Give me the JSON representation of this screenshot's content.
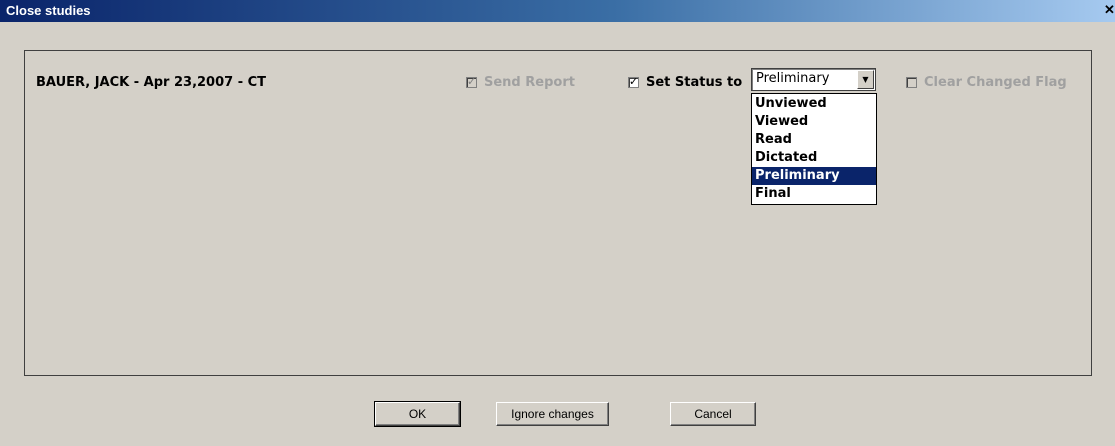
{
  "window": {
    "title": "Close studies",
    "close_glyph": "✕"
  },
  "study": {
    "label": "BAUER, JACK - Apr 23,2007 - CT"
  },
  "options": {
    "send_report": {
      "label": "Send Report",
      "checked": true,
      "enabled": false
    },
    "set_status": {
      "label": "Set Status to",
      "checked": true,
      "enabled": true
    },
    "clear_changed_flag": {
      "label": "Clear Changed Flag",
      "checked": false,
      "enabled": false
    }
  },
  "status_select": {
    "value": "Preliminary",
    "options": [
      "Unviewed",
      "Viewed",
      "Read",
      "Dictated",
      "Preliminary",
      "Final"
    ],
    "selected_index": 4
  },
  "buttons": {
    "ok": "OK",
    "ignore": "Ignore changes",
    "cancel": "Cancel"
  },
  "icons": {
    "checkmark": "✓",
    "dropdown_arrow": "▼"
  },
  "colors": {
    "titlebar_start": "#0a246a",
    "titlebar_end": "#a6caf0",
    "selection": "#0a246a",
    "dialog_bg": "#d4d0c8"
  }
}
